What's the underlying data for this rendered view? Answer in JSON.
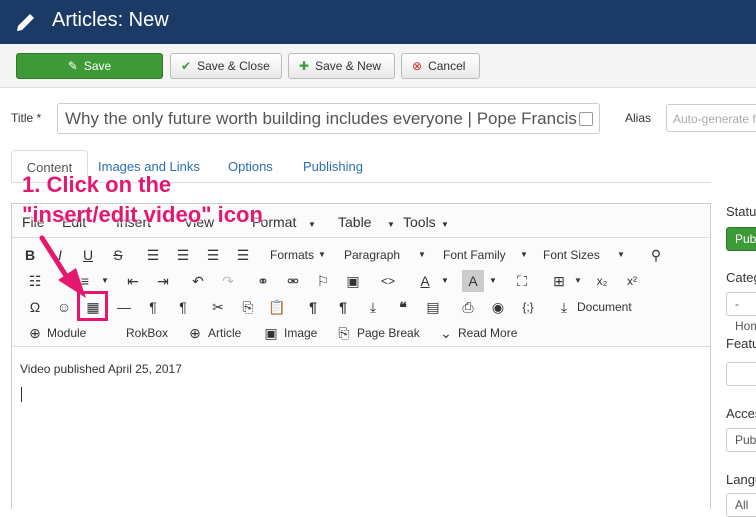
{
  "header": {
    "title": "Articles: New"
  },
  "toolbar": {
    "save": "Save",
    "save_close": "Save & Close",
    "save_new": "Save & New",
    "cancel": "Cancel"
  },
  "form": {
    "title_label": "Title *",
    "title_value": "Why the only future worth building includes everyone | Pope Francis",
    "alias_label": "Alias",
    "alias_placeholder": "Auto-generate from title"
  },
  "tabs": [
    "Content",
    "Images and Links",
    "Options",
    "Publishing"
  ],
  "editor": {
    "menus": [
      "File",
      "Edit",
      "Insert",
      "View",
      "Format",
      "Table",
      "Tools"
    ],
    "row1": {
      "formats": "Formats",
      "paragraph": "Paragraph",
      "font_family": "Font Family",
      "font_sizes": "Font Sizes"
    },
    "row3": {
      "document": "Document"
    },
    "row4": {
      "module": "Module",
      "rokbox": "RokBox",
      "article": "Article",
      "image": "Image",
      "page_break": "Page Break",
      "read_more": "Read More"
    },
    "content_text": "Video published April 25, 2017"
  },
  "sidebar": {
    "status": "Status",
    "status_value": "Published",
    "category": "Category",
    "category_value": "- Home",
    "featured": "Featured",
    "access": "Access",
    "access_value": "Public",
    "language": "Language",
    "language_value": "All"
  },
  "annotation": {
    "line1": "1. Click on the",
    "line2": "\"insert/edit video\" icon"
  },
  "colors": {
    "header": "#1b3b66",
    "save": "#3e9a37",
    "annotation": "#e5176e"
  }
}
